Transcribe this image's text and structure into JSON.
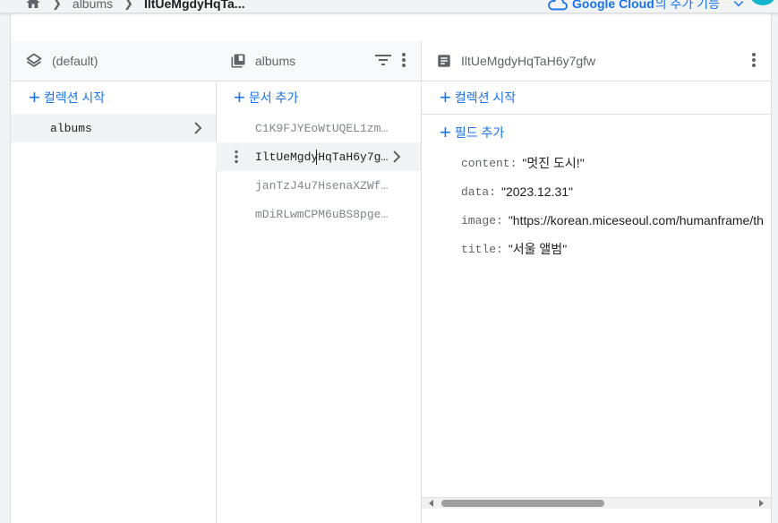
{
  "breadcrumb": {
    "items": [
      "albums",
      "IltUeMgdyHqTa..."
    ]
  },
  "google_cloud": {
    "brand": "Google Cloud",
    "suffix": "의 추가 기능"
  },
  "columns": {
    "database": {
      "title": "(default)",
      "add_label": "컬렉션 시작",
      "collections": [
        {
          "name": "albums"
        }
      ]
    },
    "collection": {
      "title": "albums",
      "add_label": "문서 추가",
      "documents": [
        {
          "id": "C1K9FJYEoWtUQEL1zm..."
        },
        {
          "id": "IltUeMgdyHqTaH6y7g..."
        },
        {
          "id": "janTzJ4u7HsenaXZWf..."
        },
        {
          "id": "mDiRLwmCPM6uBS8pge..."
        }
      ]
    },
    "document": {
      "title": "IltUeMgdyHqTaH6y7gfw",
      "add_collection_label": "컬렉션 시작",
      "add_field_label": "필드 추가",
      "fields": [
        {
          "key": "content:",
          "value": "\"멋진 도시!\""
        },
        {
          "key": "data:",
          "value": "\"2023.12.31\""
        },
        {
          "key": "image:",
          "value": "\"https://korean.miceseoul.com/humanframe/th"
        },
        {
          "key": "title:",
          "value": "\"서울 앨범\""
        }
      ]
    }
  },
  "colors": {
    "accent": "#1a73e8",
    "selected_bg": "#f1f3f4",
    "avatar": "#12b5cb"
  }
}
